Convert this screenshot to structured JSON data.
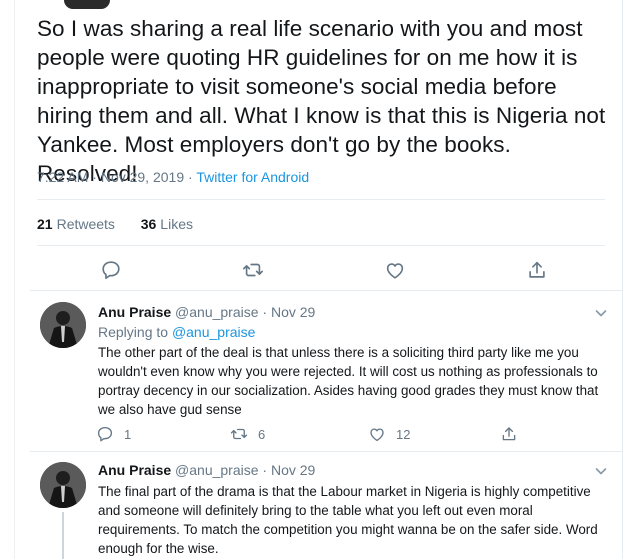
{
  "main_tweet": {
    "text": "So I was sharing a real life scenario with you and most people were quoting HR guidelines for on me how it is inappropriate to visit someone's social media before hiring them and all. What I know is that this is Nigeria not Yankee. Most employers don't go by the books. Resolved!",
    "time": "7:22 AM",
    "date": "Nov 29, 2019",
    "separator": "·",
    "via": "Twitter for Android",
    "retweets_count": "21",
    "retweets_label": "Retweets",
    "likes_count": "36",
    "likes_label": "Likes"
  },
  "main_actions": [
    {
      "icon": "reply-icon"
    },
    {
      "icon": "retweet-icon"
    },
    {
      "icon": "like-icon"
    },
    {
      "icon": "share-icon"
    }
  ],
  "replies": [
    {
      "name": "Anu Praise",
      "handle": "@anu_praise",
      "dot": "·",
      "date": "Nov 29",
      "replying_prefix": "Replying to",
      "replying_to": "@anu_praise",
      "text": "The other part of the deal is that unless there is a soliciting third party like me you wouldn't even know why you were rejected. It will cost us nothing as professionals to portray decency in our socialization. Asides having good grades they must know that we also have gud sense",
      "reply_count": "1",
      "retweet_count": "6",
      "like_count": "12"
    },
    {
      "name": "Anu Praise",
      "handle": "@anu_praise",
      "dot": "·",
      "date": "Nov 29",
      "text": "The final part of the drama is that the Labour market in Nigeria is highly competitive and someone will definitely bring to the table what you left out even moral requirements. To match the competition you might wanna be on the safer side. Word enough for the wise."
    }
  ],
  "colors": {
    "link": "#1b95e0",
    "muted": "#657786",
    "text": "#14171a",
    "divider": "#e6ecf0"
  }
}
